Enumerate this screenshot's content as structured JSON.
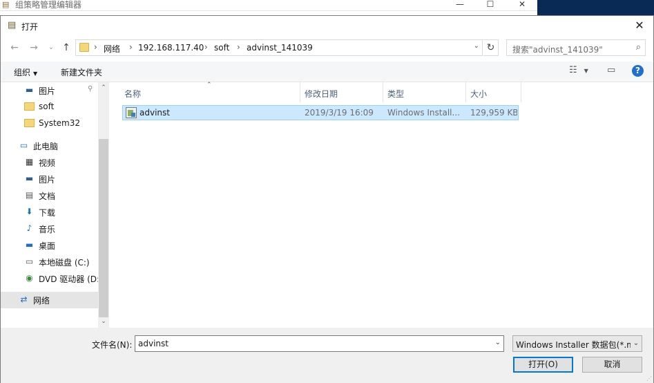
{
  "background_window": {
    "title": "组策略管理编辑器",
    "controls": {
      "minimize": "—",
      "maximize": "☐",
      "close": "✕"
    }
  },
  "dialog": {
    "title": "打开",
    "close_glyph": "✕"
  },
  "navigation": {
    "back": "←",
    "forward": "→",
    "recent": "⌄",
    "up": "↑",
    "refresh": "↻"
  },
  "address": {
    "segments": [
      "网络",
      "192.168.117.40",
      "soft",
      "advinst_141039"
    ],
    "separator": "›",
    "dropdown": "⌄"
  },
  "search": {
    "placeholder": "搜索\"advinst_141039\"",
    "icon": "⌕"
  },
  "toolbar": {
    "organize": "组织",
    "new_folder": "新建文件夹",
    "view_icon": "☷",
    "pane_icon": "▭",
    "help": "?"
  },
  "sidebar": {
    "pin": "📌",
    "items": [
      {
        "label": "图片",
        "icon": "pictures-icon",
        "glyph": "▬"
      },
      {
        "label": "soft",
        "icon": "folder-icon",
        "glyph": ""
      },
      {
        "label": "System32",
        "icon": "folder-icon",
        "glyph": ""
      },
      {
        "label": "此电脑",
        "icon": "computer-icon",
        "glyph": "▭"
      },
      {
        "label": "视频",
        "icon": "video-icon",
        "glyph": "▦"
      },
      {
        "label": "图片",
        "icon": "pictures-icon",
        "glyph": "▬"
      },
      {
        "label": "文档",
        "icon": "document-icon",
        "glyph": "▤"
      },
      {
        "label": "下载",
        "icon": "download-icon",
        "glyph": "⬇"
      },
      {
        "label": "音乐",
        "icon": "music-icon",
        "glyph": "♪"
      },
      {
        "label": "桌面",
        "icon": "desktop-icon",
        "glyph": "▬"
      },
      {
        "label": "本地磁盘 (C:)",
        "icon": "drive-icon",
        "glyph": "▭"
      },
      {
        "label": "DVD 驱动器 (D:",
        "icon": "dvd-icon",
        "glyph": "◉"
      },
      {
        "label": "网络",
        "icon": "network-icon",
        "glyph": "⇄"
      }
    ],
    "scroll_up": "⌃",
    "scroll_down": "⌄"
  },
  "file_list": {
    "columns": [
      "名称",
      "修改日期",
      "类型",
      "大小"
    ],
    "sort_glyph": "⌃",
    "rows": [
      {
        "name": "advinst",
        "date": "2019/3/19 16:09",
        "type": "Windows Install...",
        "size": "129,959 KB"
      }
    ]
  },
  "bottom": {
    "filename_label": "文件名(N):",
    "filename_value": "advinst",
    "filetype_value": "Windows Installer 数据包(*.m",
    "dropdown": "⌄",
    "open_button": "打开(O)",
    "cancel_button": "取消"
  },
  "colors": {
    "selection": "#cce8ff",
    "selection_border": "#99d1ff",
    "accent": "#0078d7",
    "help": "#1f6fd1",
    "folder": "#f5d77a"
  }
}
